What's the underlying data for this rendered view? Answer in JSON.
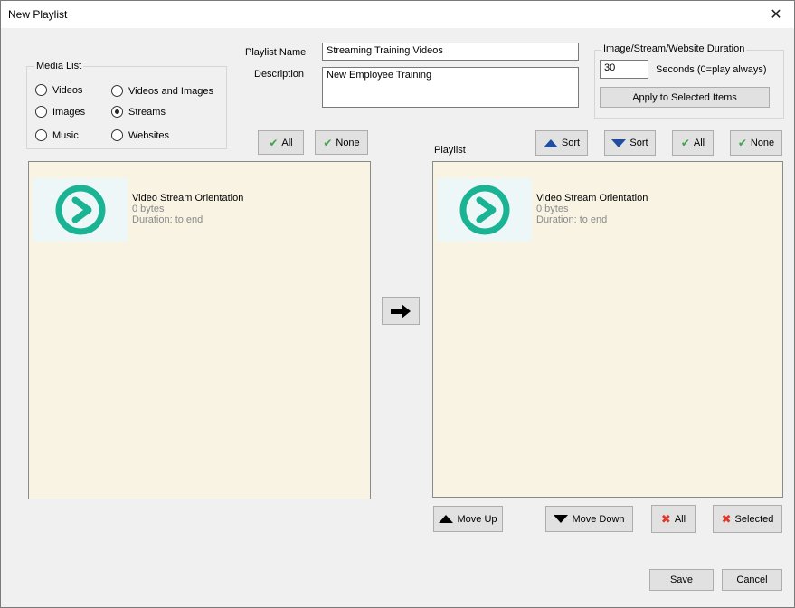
{
  "window": {
    "title": "New Playlist",
    "close_glyph": "✕"
  },
  "media_list": {
    "legend": "Media List",
    "options": [
      {
        "label": "Videos",
        "selected": false
      },
      {
        "label": "Videos and Images",
        "selected": false
      },
      {
        "label": "Images",
        "selected": false
      },
      {
        "label": "Streams",
        "selected": true
      },
      {
        "label": "Music",
        "selected": false
      },
      {
        "label": "Websites",
        "selected": false
      }
    ],
    "all_label": "All",
    "none_label": "None",
    "items": [
      {
        "title": "Video Stream Orientation",
        "size": "0 bytes",
        "duration": "Duration: to end",
        "icon": "play-circle-icon"
      }
    ]
  },
  "playlist_name": {
    "label": "Playlist Name",
    "value": "Streaming Training Videos"
  },
  "description": {
    "label": "Description",
    "value": "New Employee Training"
  },
  "duration": {
    "legend": "Image/Stream/Website Duration",
    "value": "30",
    "units_label": "Seconds (0=play always)",
    "apply_label": "Apply to Selected Items"
  },
  "transfer": {
    "icon": "arrow-right-icon"
  },
  "playlist": {
    "label": "Playlist",
    "sort_asc_label": "Sort",
    "sort_desc_label": "Sort",
    "all_label": "All",
    "none_label": "None",
    "items": [
      {
        "title": "Video Stream Orientation",
        "size": "0 bytes",
        "duration": "Duration: to end",
        "icon": "play-circle-icon"
      }
    ],
    "move_up_label": "Move Up",
    "move_down_label": "Move Down",
    "remove_all_label": "All",
    "remove_selected_label": "Selected"
  },
  "footer": {
    "save_label": "Save",
    "cancel_label": "Cancel"
  },
  "colors": {
    "accent": "#1ab394",
    "list_bg": "#f8f3e3",
    "sort_arrow": "#1f4ea1"
  }
}
